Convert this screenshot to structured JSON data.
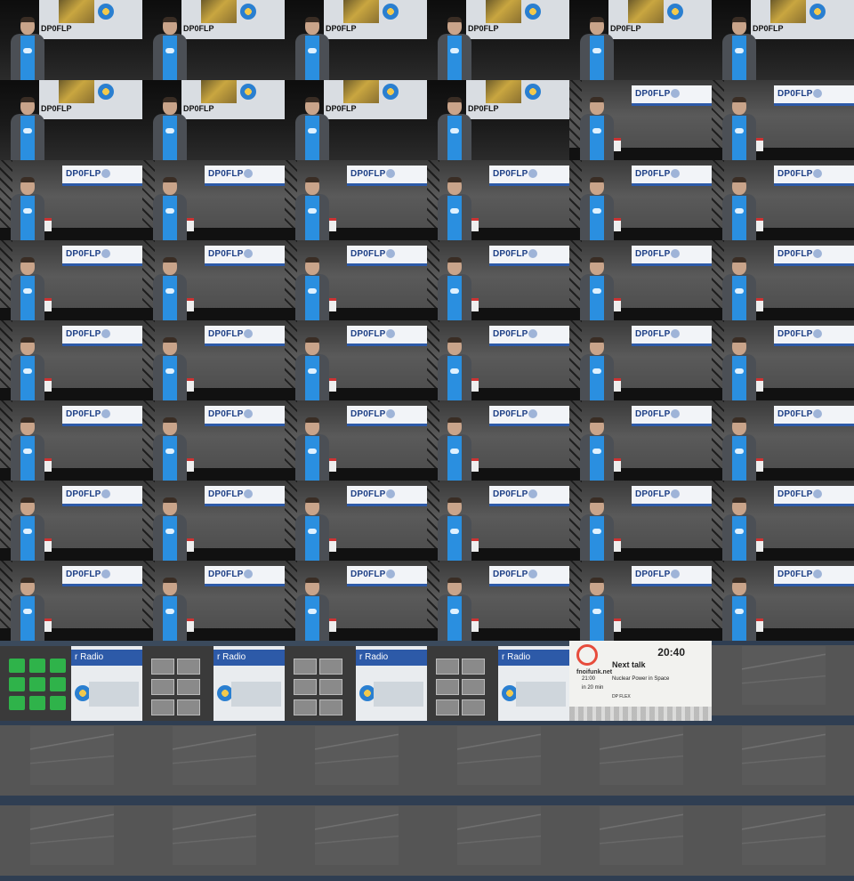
{
  "frames": [
    "earth",
    "earth",
    "earth",
    "earth",
    "earth",
    "earth",
    "earth",
    "earth",
    "earth",
    "earth",
    "banner",
    "banner",
    "banner",
    "banner",
    "banner",
    "banner",
    "banner",
    "banner",
    "banner",
    "banner",
    "banner",
    "banner",
    "banner",
    "banner",
    "banner",
    "banner",
    "banner",
    "banner",
    "banner",
    "banner",
    "banner",
    "banner",
    "banner",
    "banner",
    "banner",
    "banner",
    "banner",
    "banner",
    "banner",
    "banner",
    "banner",
    "banner",
    "banner",
    "banner",
    "banner",
    "banner",
    "banner",
    "banner",
    "screen-folders",
    "screen-thumbs",
    "screen-thumbs",
    "screen-thumbs",
    "schedule",
    "grey",
    "grey",
    "grey",
    "grey",
    "grey",
    "grey",
    "grey",
    "grey",
    "grey",
    "grey",
    "grey",
    "grey",
    "grey"
  ],
  "slide": {
    "callsign": "DP0FLP"
  },
  "screen": {
    "title": "r Radio"
  },
  "schedule": {
    "site": "fnoifunk.net",
    "clock": "20:40",
    "next_label": "Next talk",
    "start": "21:00",
    "relative": "in 20 min",
    "talk_title": "Nuclear Power in Space",
    "room": "DP FLEX"
  }
}
